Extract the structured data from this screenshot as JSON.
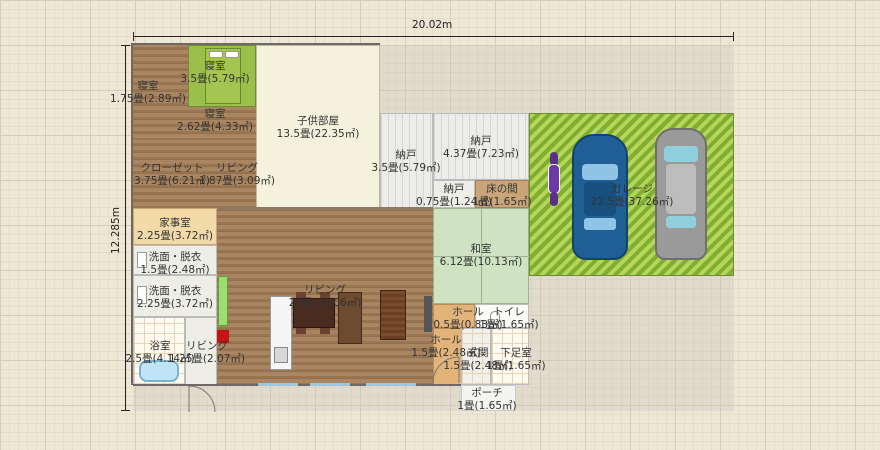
{
  "dimensions": {
    "width": "20.02m",
    "height": "12.285m"
  },
  "rooms": [
    {
      "id": "bedroom-small",
      "name": "寝室",
      "area": "1.75畳(2.89㎡)"
    },
    {
      "id": "bedroom-top",
      "name": "寝室",
      "area": "3.5畳(5.79㎡)"
    },
    {
      "id": "bedroom-mid",
      "name": "寝室",
      "area": "2.62畳(4.33㎡)"
    },
    {
      "id": "kids-room",
      "name": "子供部屋",
      "area": "13.5畳(22.35㎡)"
    },
    {
      "id": "closet",
      "name": "クローゼット",
      "area": "3.75畳(6.21㎡)"
    },
    {
      "id": "living-small",
      "name": "リビング",
      "area": "1.87畳(3.09㎡)"
    },
    {
      "id": "storage-left",
      "name": "納戸",
      "area": "3.5畳(5.79㎡)"
    },
    {
      "id": "storage-right",
      "name": "納戸",
      "area": "4.37畳(7.23㎡)"
    },
    {
      "id": "storage-small",
      "name": "納戸",
      "area": "0.75畳(1.24㎡)"
    },
    {
      "id": "tokonoma",
      "name": "床の間",
      "area": "1畳(1.65㎡)"
    },
    {
      "id": "garage",
      "name": "ガレージ",
      "area": "22.5畳(37.26㎡)"
    },
    {
      "id": "utility",
      "name": "家事室",
      "area": "2.25畳(3.72㎡)"
    },
    {
      "id": "washroom-1",
      "name": "洗面・脱衣",
      "area": "1.5畳(2.48㎡)"
    },
    {
      "id": "washroom-2",
      "name": "洗面・脱衣",
      "area": "2.25畳(3.72㎡)"
    },
    {
      "id": "washitsu",
      "name": "和室",
      "area": "6.12畳(10.13㎡)"
    },
    {
      "id": "living-main",
      "name": "リビング",
      "area": "26畳(43.06㎡)"
    },
    {
      "id": "hall-top",
      "name": "ホール",
      "area": "0.5畳(0.83㎡)"
    },
    {
      "id": "toilet",
      "name": "トイレ",
      "area": "1畳(1.65㎡)"
    },
    {
      "id": "hall-bottom",
      "name": "ホール",
      "area": "1.5畳(2.48㎡)"
    },
    {
      "id": "entrance",
      "name": "玄関",
      "area": "1.5畳(2.48㎡)"
    },
    {
      "id": "shoe-room",
      "name": "下足室",
      "area": "1畳(1.65㎡)"
    },
    {
      "id": "bathroom",
      "name": "浴室",
      "area": "2.5畳(4.14㎡)"
    },
    {
      "id": "living-bath",
      "name": "リビング",
      "area": "1.25畳(2.07㎡)"
    },
    {
      "id": "porch",
      "name": "ポーチ",
      "area": "1畳(1.65㎡)"
    }
  ],
  "colors": {
    "car_blue": "#1f5f96",
    "car_gray": "#9a9a9a",
    "motorbike": "#5b2d8c",
    "garage_green": "#8dbb3e"
  }
}
